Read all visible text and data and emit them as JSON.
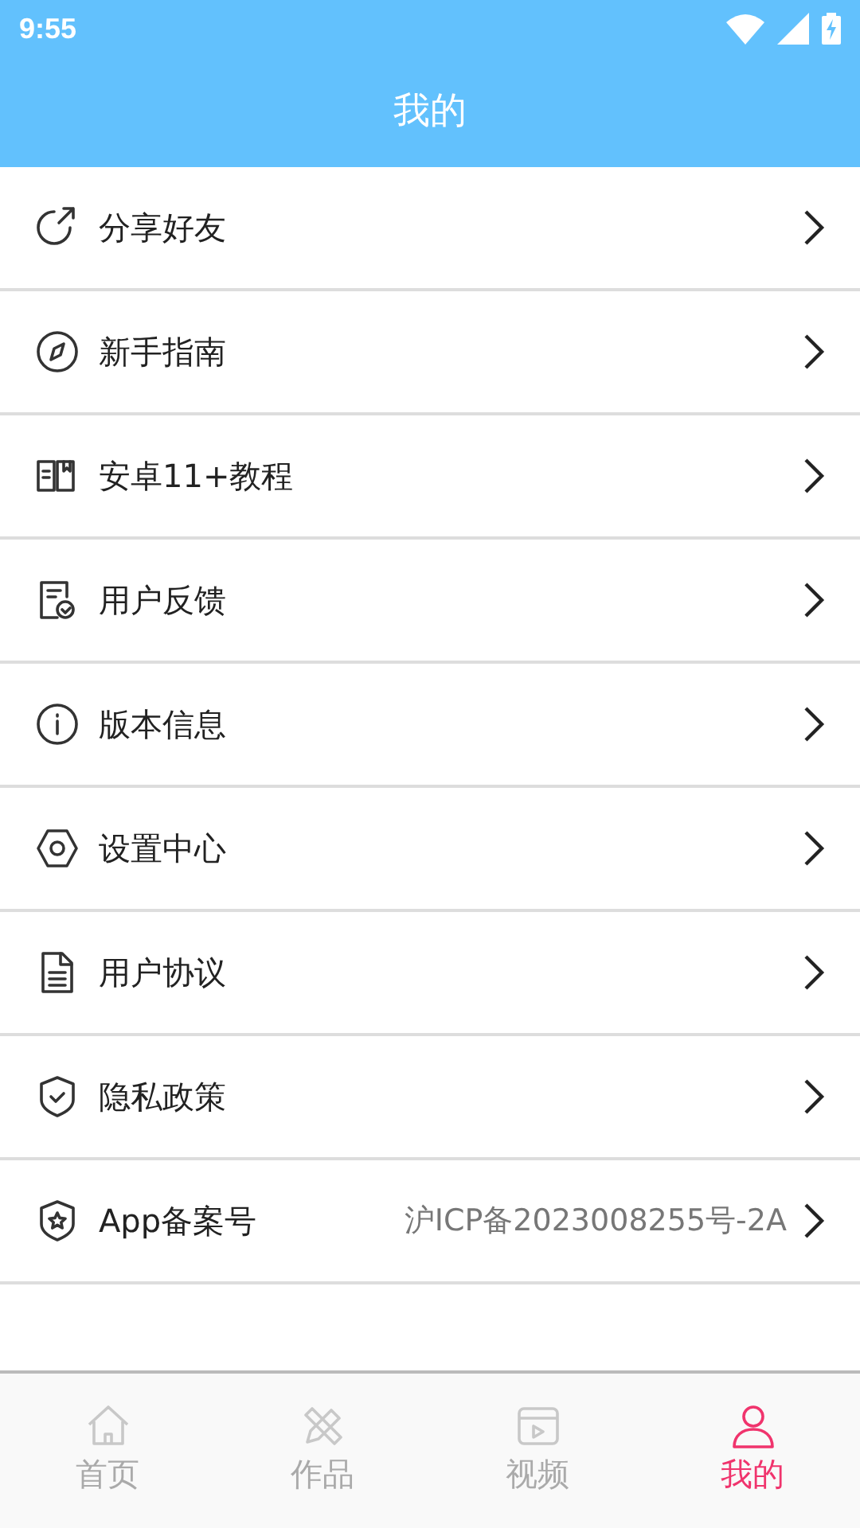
{
  "status_bar": {
    "time": "9:55"
  },
  "header": {
    "title": "我的"
  },
  "menu": [
    {
      "label": "分享好友"
    },
    {
      "label": "新手指南"
    },
    {
      "label": "安卓11+教程"
    },
    {
      "label": "用户反馈"
    },
    {
      "label": "版本信息"
    },
    {
      "label": "设置中心"
    },
    {
      "label": "用户协议"
    },
    {
      "label": "隐私政策"
    },
    {
      "label": "App备案号",
      "value": "沪ICP备2023008255号-2A"
    }
  ],
  "bottom_nav": [
    {
      "label": "首页",
      "selected": false
    },
    {
      "label": "作品",
      "selected": false
    },
    {
      "label": "视频",
      "selected": false
    },
    {
      "label": "我的",
      "selected": true
    }
  ]
}
